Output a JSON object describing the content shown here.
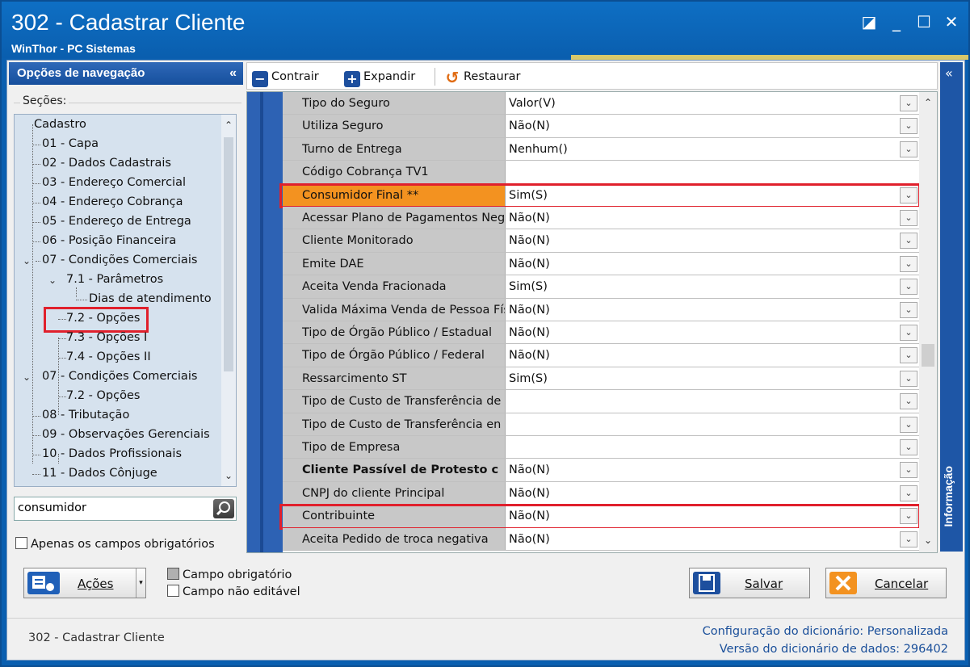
{
  "window": {
    "title": "302 - Cadastrar Cliente",
    "subtitle": "WinThor - PC Sistemas",
    "controls": [
      "◪",
      "_",
      "☐",
      "✕"
    ]
  },
  "nav": {
    "header": "Opções de navegação",
    "collapse_glyph": "«",
    "sections_label": "Seções:",
    "items": [
      "Cadastro",
      "01 - Capa",
      "02 - Dados Cadastrais",
      "03 - Endereço Comercial",
      "04 - Endereço Cobrança",
      "05 - Endereço de Entrega",
      "06 - Posição Financeira",
      "07 - Condições Comerciais",
      "7.1 - Parâmetros",
      "Dias de atendimento",
      "7.2 - Opções",
      "7.3 - Opções I",
      "7.4 - Opções II",
      "07 - Condições Comerciais",
      "7.2 - Opções",
      "08 - Tributação",
      "09 - Observações Gerenciais",
      "10 - Dados Profissionais",
      "11 - Dados Cônjuge"
    ],
    "search_value": "consumidor",
    "required_only_label": "Apenas os campos obrigatórios"
  },
  "toolbar": {
    "contrair": "Contrair",
    "expandir": "Expandir",
    "restaurar": "Restaurar"
  },
  "grid": {
    "rows": [
      {
        "label": "Tipo do Seguro",
        "value": "Valor(V)",
        "dropdown": true
      },
      {
        "label": "Utiliza Seguro",
        "value": "Não(N)",
        "dropdown": true
      },
      {
        "label": "Turno de Entrega",
        "value": "Nenhum()",
        "dropdown": true
      },
      {
        "label": "Código Cobrança TV1",
        "value": "",
        "dropdown": false
      },
      {
        "label": "Consumidor Final **",
        "value": "Sim(S)",
        "dropdown": true
      },
      {
        "label": "Acessar Plano de Pagamentos Neg",
        "value": "Não(N)",
        "dropdown": true
      },
      {
        "label": "Cliente Monitorado",
        "value": "Não(N)",
        "dropdown": true
      },
      {
        "label": "Emite DAE",
        "value": "Não(N)",
        "dropdown": true
      },
      {
        "label": "Aceita Venda Fracionada",
        "value": "Sim(S)",
        "dropdown": true
      },
      {
        "label": "Valida Máxima Venda de Pessoa Fís",
        "value": "Não(N)",
        "dropdown": true
      },
      {
        "label": "Tipo de Órgão Público / Estadual",
        "value": "Não(N)",
        "dropdown": true
      },
      {
        "label": "Tipo de Órgão Público / Federal",
        "value": "Não(N)",
        "dropdown": true
      },
      {
        "label": "Ressarcimento ST",
        "value": "Sim(S)",
        "dropdown": true
      },
      {
        "label": "Tipo de Custo de Transferência de",
        "value": "",
        "dropdown": true
      },
      {
        "label": "Tipo de Custo de Transferência en",
        "value": "",
        "dropdown": true
      },
      {
        "label": "Tipo de Empresa",
        "value": "",
        "dropdown": true
      },
      {
        "label": "Cliente Passível de Protesto c",
        "value": "Não(N)",
        "dropdown": true
      },
      {
        "label": "CNPJ do cliente Principal",
        "value": "Não(N)",
        "dropdown": true
      },
      {
        "label": "Contribuinte",
        "value": "Não(N)",
        "dropdown": true
      },
      {
        "label": "Aceita Pedido de troca negativa",
        "value": "Não(N)",
        "dropdown": true
      }
    ]
  },
  "side_panel": {
    "label": "Informação",
    "collapse_glyph": "«"
  },
  "bottom": {
    "acoes": "Ações",
    "legend_required": "Campo obrigatório",
    "legend_readonly": "Campo não editável",
    "salvar": "Salvar",
    "cancelar": "Cancelar"
  },
  "status": {
    "left": "302 - Cadastrar Cliente",
    "dict_config_label": "Configuração do dicionário:",
    "dict_config_value": "Personalizada",
    "dict_version_label": "Versão do dicionário de dados:",
    "dict_version_value": "296402"
  },
  "colors": {
    "highlight_row": "#f39220",
    "red_box": "#e0202c",
    "title_bar": "#0a5fb0"
  }
}
